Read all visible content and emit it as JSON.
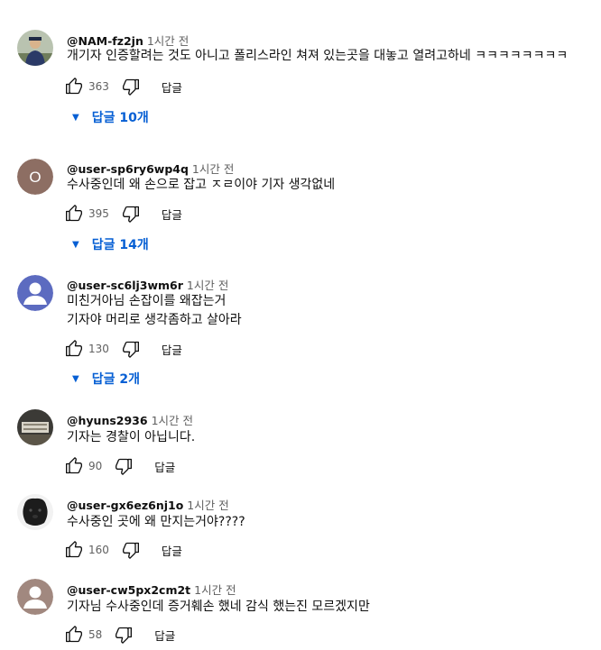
{
  "comments": [
    {
      "handle": "@NAM-fz2jn",
      "time": "1시간 전",
      "lines": [
        "개기자 인증할려는 것도 아니고 폴리스라인 쳐져 있는곳을 대놓고 열려고하네 ㅋㅋㅋㅋㅋㅋㅋㅋ"
      ],
      "likes": "363",
      "reply_label": "답글",
      "replies_label": "답글 10개",
      "avatar": "photo-person"
    },
    {
      "handle": "@user-sp6ry6wp4q",
      "time": "1시간 전",
      "lines": [
        "수사중인데 왜 손으로 잡고 ㅈㄹ이야 기자 생각없네"
      ],
      "likes": "395",
      "reply_label": "답글",
      "replies_label": "답글 14개",
      "avatar_letter": "O",
      "avatar_color": "#8d6e63"
    },
    {
      "handle": "@user-sc6lj3wm6r",
      "time": "1시간 전",
      "lines": [
        "미친거아님 손잡이를 왜잡는거",
        "기자야 머리로 생각좀하고 살아라"
      ],
      "likes": "130",
      "reply_label": "답글",
      "replies_label": "답글 2개",
      "avatar": "default-user",
      "avatar_color": "#5c6bc0"
    },
    {
      "handle": "@hyuns2936",
      "time": "1시간 전",
      "lines": [
        "기자는 경찰이 아닙니다."
      ],
      "likes": "90",
      "reply_label": "답글",
      "avatar": "photo-building"
    },
    {
      "handle": "@user-gx6ez6nj1o",
      "time": "1시간 전",
      "lines": [
        "수사중인 곳에 왜 만지는거야????"
      ],
      "likes": "160",
      "reply_label": "답글",
      "avatar": "photo-dog"
    },
    {
      "handle": "@user-cw5px2cm2t",
      "time": "1시간 전",
      "lines": [
        "기자님 수사중인데 증거훼손 했네 감식 했는진 모르겠지만"
      ],
      "likes": "58",
      "reply_label": "답글",
      "avatar": "default-user",
      "avatar_color": "#a1887f"
    }
  ],
  "icons": {
    "like": "thumbs-up-icon",
    "dislike": "thumbs-down-icon",
    "expand": "caret-down-icon"
  },
  "colors": {
    "link": "#065fd4",
    "secondary_text": "#606060"
  }
}
